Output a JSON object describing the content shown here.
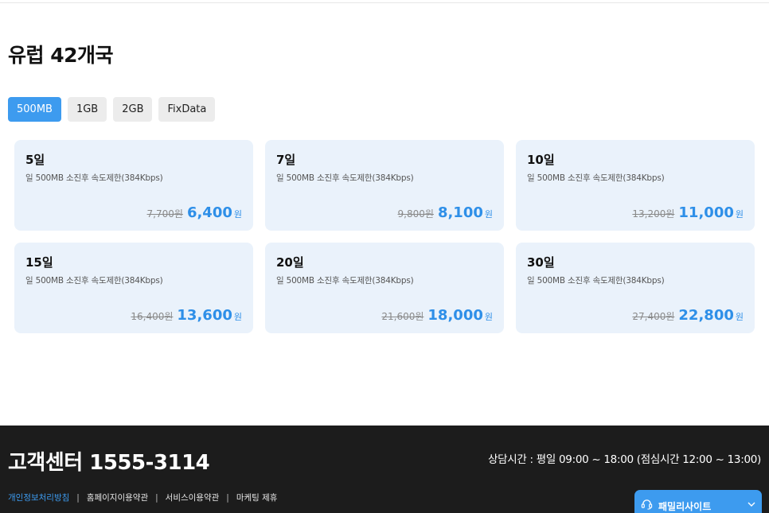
{
  "page": {
    "title": "유럽 42개국"
  },
  "tabs": [
    {
      "label": "500MB",
      "active": true
    },
    {
      "label": "1GB",
      "active": false
    },
    {
      "label": "2GB",
      "active": false
    },
    {
      "label": "FixData",
      "active": false
    }
  ],
  "plans": [
    {
      "days": "5일",
      "desc": "일 500MB 소진후 속도제한(384Kbps)",
      "old_price": "7,700원",
      "price": "6,400",
      "unit": "원"
    },
    {
      "days": "7일",
      "desc": "일 500MB 소진후 속도제한(384Kbps)",
      "old_price": "9,800원",
      "price": "8,100",
      "unit": "원"
    },
    {
      "days": "10일",
      "desc": "일 500MB 소진후 속도제한(384Kbps)",
      "old_price": "13,200원",
      "price": "11,000",
      "unit": "원"
    },
    {
      "days": "15일",
      "desc": "일 500MB 소진후 속도제한(384Kbps)",
      "old_price": "16,400원",
      "price": "13,600",
      "unit": "원"
    },
    {
      "days": "20일",
      "desc": "일 500MB 소진후 속도제한(384Kbps)",
      "old_price": "21,600원",
      "price": "18,000",
      "unit": "원"
    },
    {
      "days": "30일",
      "desc": "일 500MB 소진후 속도제한(384Kbps)",
      "old_price": "27,400원",
      "price": "22,800",
      "unit": "원"
    }
  ],
  "footer": {
    "customer_center": "고객센터 1555-3114",
    "hours": "상담시간 : 평일 09:00 ~ 18:00 (점심시간 12:00 ~ 13:00)",
    "links": [
      {
        "label": "개인정보처리방침",
        "highlight": true
      },
      {
        "label": "홈페이지이용약관",
        "highlight": false
      },
      {
        "label": "서비스이용약관",
        "highlight": false
      },
      {
        "label": "마케팅 제휴",
        "highlight": false
      }
    ],
    "separator": "|",
    "family_site": {
      "label": "패밀리사이트",
      "icon": "headset-icon"
    }
  },
  "colors": {
    "accent": "#3d9bef",
    "price": "#2e8fe8",
    "card_bg": "#eaf2fb",
    "footer_bg": "#1c1c1c"
  }
}
